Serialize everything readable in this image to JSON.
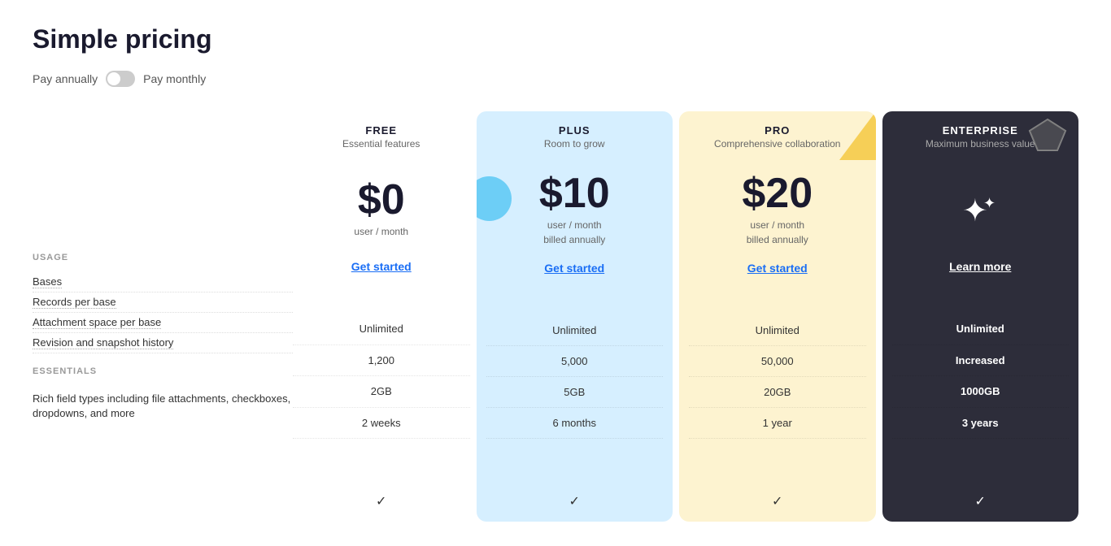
{
  "page": {
    "title": "Simple pricing"
  },
  "billing": {
    "pay_annually": "Pay annually",
    "pay_monthly": "Pay monthly"
  },
  "plans": [
    {
      "id": "free",
      "name": "FREE",
      "tagline": "Essential features",
      "price": "$0",
      "price_sub": "user / month",
      "cta": "Get started",
      "theme": "default",
      "bases": "Unlimited",
      "records": "1,200",
      "attachment": "2GB",
      "history": "2 weeks",
      "rich_fields": "check"
    },
    {
      "id": "plus",
      "name": "PLUS",
      "tagline": "Room to grow",
      "price": "$10",
      "price_sub": "user / month\nbilled annually",
      "cta": "Get started",
      "theme": "plus",
      "bases": "Unlimited",
      "records": "5,000",
      "attachment": "5GB",
      "history": "6 months",
      "rich_fields": "check"
    },
    {
      "id": "pro",
      "name": "PRO",
      "tagline": "Comprehensive collaboration",
      "price": "$20",
      "price_sub": "user / month\nbilled annually",
      "cta": "Get started",
      "theme": "pro",
      "bases": "Unlimited",
      "records": "50,000",
      "attachment": "20GB",
      "history": "1 year",
      "rich_fields": "check"
    },
    {
      "id": "enterprise",
      "name": "ENTERPRISE",
      "tagline": "Maximum business value",
      "price": "",
      "price_sub": "",
      "cta": "Learn more",
      "theme": "enterprise",
      "bases": "Unlimited",
      "records": "Increased",
      "attachment": "1000GB",
      "history": "3 years",
      "rich_fields": "check"
    }
  ],
  "features": {
    "usage_label": "USAGE",
    "essentials_label": "ESSENTIALS",
    "rows": [
      {
        "id": "bases",
        "label": "Bases"
      },
      {
        "id": "records",
        "label": "Records per base"
      },
      {
        "id": "attachment",
        "label": "Attachment space per base"
      },
      {
        "id": "history",
        "label": "Revision and snapshot history"
      }
    ],
    "essentials_rows": [
      {
        "id": "rich_fields",
        "label": "Rich field types including file attachments, checkboxes, dropdowns, and more"
      }
    ]
  }
}
